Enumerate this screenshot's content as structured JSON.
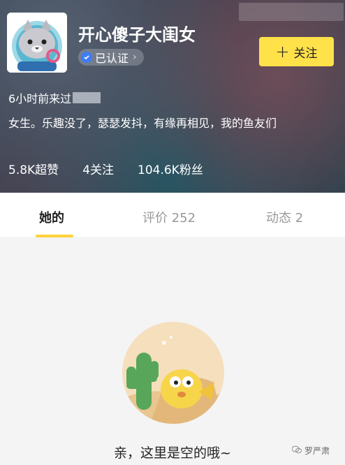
{
  "profile": {
    "name": "开心傻子大闺女",
    "certified_label": "已认证",
    "follow_label": "关注",
    "last_visit": "6小时前来过",
    "bio": "女生。乐趣没了，瑟瑟发抖，有缘再相见，我的鱼友们"
  },
  "stats": {
    "likes": "5.8K超赞",
    "following": "4关注",
    "fans": "104.6K粉丝"
  },
  "tabs": {
    "hers": "她的",
    "reviews": "评价 252",
    "posts": "动态 2"
  },
  "empty_state": {
    "message": "亲，这里是空的哦~"
  },
  "watermark": {
    "text": "罗严肃"
  },
  "colors": {
    "accent": "#ffe14a",
    "tab_indicator": "#ffd23b",
    "cert_badge": "#3f7bf6"
  }
}
